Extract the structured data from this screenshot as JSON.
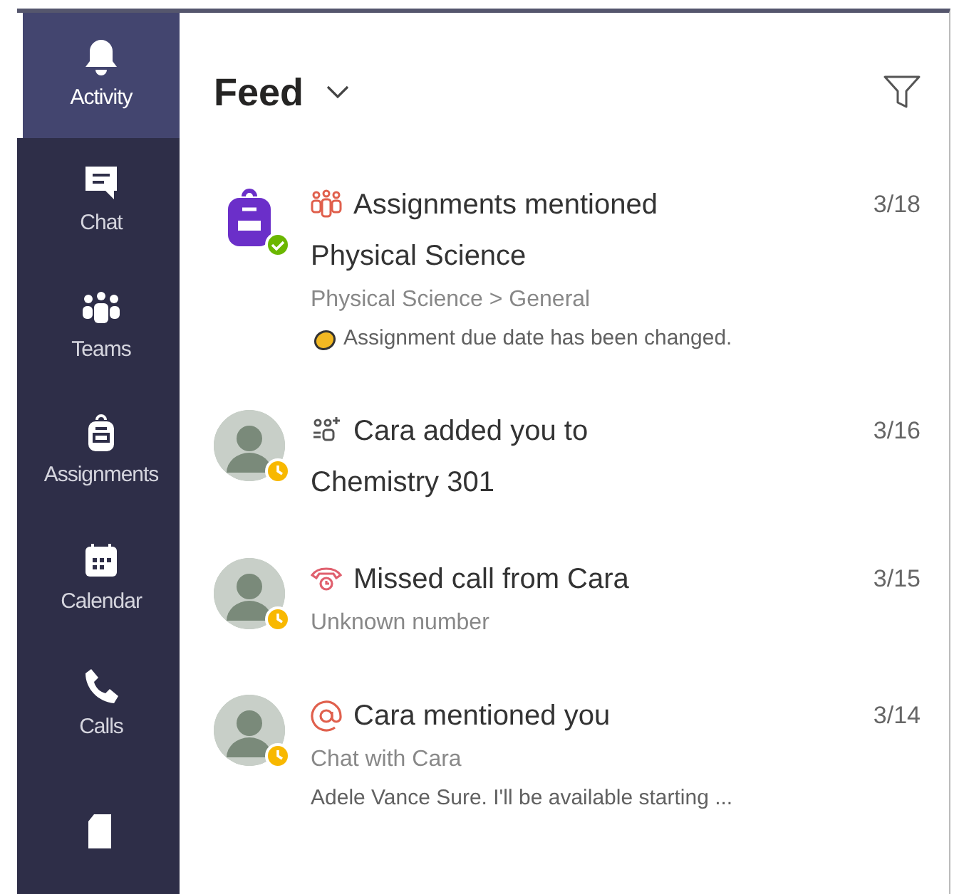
{
  "sidebar": {
    "items": [
      {
        "kind": "bell",
        "label": "Activity",
        "selected": true
      },
      {
        "kind": "chat",
        "label": "Chat",
        "selected": false
      },
      {
        "kind": "teams",
        "label": "Teams",
        "selected": false
      },
      {
        "kind": "backpack",
        "label": "Assignments",
        "selected": false
      },
      {
        "kind": "calendar",
        "label": "Calendar",
        "selected": false
      },
      {
        "kind": "phone",
        "label": "Calls",
        "selected": false
      },
      {
        "kind": "file",
        "selected": false
      }
    ]
  },
  "header": {
    "title": "Feed"
  },
  "feed": [
    {
      "kind": "assignment",
      "title": "Assignments mentioned",
      "date": "3/18",
      "heading": "Physical Science",
      "subtitle": "Physical Science > General",
      "preview": "Assignment due date has been changed."
    },
    {
      "kind": "added",
      "title": "Cara added you to",
      "date": "3/16",
      "heading": "Chemistry 301"
    },
    {
      "kind": "call",
      "title": "Missed call from Cara",
      "date": "3/15",
      "subtitle": "Unknown number"
    },
    {
      "kind": "mention",
      "title": "Cara mentioned you",
      "date": "3/14",
      "subtitle": "Chat with Cara",
      "preview": "Adele Vance Sure. I'll be available starting ..."
    }
  ]
}
